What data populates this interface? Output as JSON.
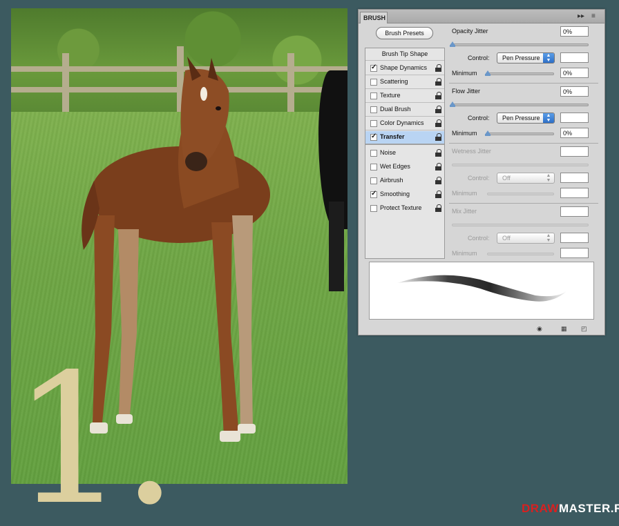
{
  "panel": {
    "tab_title": "BRUSH",
    "top_icons": {
      "collapse": "double-arrow-icon",
      "menu": "panel-menu-icon"
    },
    "presets_button": "Brush Presets",
    "list_header": "Brush Tip Shape",
    "items": [
      {
        "label": "Shape Dynamics",
        "checked": true
      },
      {
        "label": "Scattering",
        "checked": false
      },
      {
        "label": "Texture",
        "checked": false
      },
      {
        "label": "Dual Brush",
        "checked": false
      },
      {
        "label": "Color Dynamics",
        "checked": false
      },
      {
        "label": "Transfer",
        "checked": true,
        "selected": true
      },
      {
        "label": "Noise",
        "checked": false
      },
      {
        "label": "Wet Edges",
        "checked": false
      },
      {
        "label": "Airbrush",
        "checked": false
      },
      {
        "label": "Smoothing",
        "checked": true
      },
      {
        "label": "Protect Texture",
        "checked": false
      }
    ],
    "settings": {
      "opacity_jitter": {
        "label": "Opacity Jitter",
        "value": "0%"
      },
      "control_label": "Control:",
      "opacity_control": "Pen Pressure",
      "opacity_control_value": "",
      "minimum_label": "Minimum",
      "opacity_minimum": "0%",
      "flow_jitter": {
        "label": "Flow Jitter",
        "value": "0%"
      },
      "flow_control": "Pen Pressure",
      "flow_control_value": "",
      "flow_minimum": "0%",
      "wetness_jitter": {
        "label": "Wetness Jitter",
        "value": ""
      },
      "wetness_control": "Off",
      "wetness_control_value": "",
      "wetness_minimum": "",
      "mix_jitter": {
        "label": "Mix Jitter",
        "value": ""
      },
      "mix_control": "Off",
      "mix_control_value": "",
      "mix_minimum": ""
    },
    "bottom_icons": [
      "eye-brush-icon",
      "grid-icon",
      "new-preset-icon"
    ]
  },
  "numeral": "1.",
  "logo": {
    "part1": "DRAW",
    "part2": "MASTER.RU"
  },
  "colors": {
    "background": "#3c5a60",
    "numeral": "#dccf9e",
    "selected_row": "#b9d4f3",
    "logo_red": "#d92020"
  }
}
